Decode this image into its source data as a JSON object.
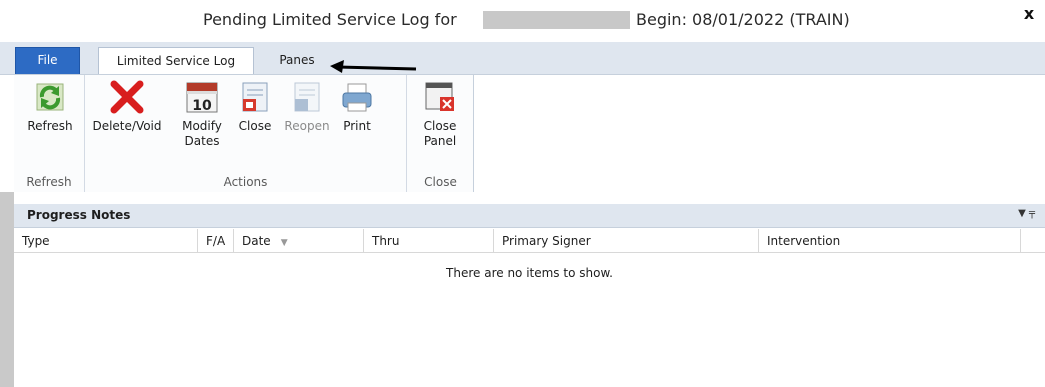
{
  "window": {
    "title_left": "Pending Limited Service Log for",
    "title_right": "Begin: 08/01/2022 (TRAIN)",
    "close_glyph": "x"
  },
  "tabs": {
    "file": "File",
    "active": "Limited Service Log",
    "panes": "Panes"
  },
  "ribbon": {
    "groups": {
      "refresh": "Refresh",
      "actions": "Actions",
      "close": "Close"
    },
    "buttons": {
      "refresh": "Refresh",
      "delete_void": "Delete/Void",
      "modify_dates_1": "Modify",
      "modify_dates_2": "Dates",
      "close": "Close",
      "reopen": "Reopen",
      "print": "Print",
      "close_panel_1": "Close",
      "close_panel_2": "Panel"
    }
  },
  "panel": {
    "title": "Progress Notes",
    "columns": [
      "Type",
      "F/A",
      "Date",
      "Thru",
      "Primary Signer",
      "Intervention"
    ],
    "empty_message": "There are no items to show."
  },
  "colors": {
    "file_tab": "#2d6bc4",
    "tab_bar": "#dfe6ef"
  }
}
